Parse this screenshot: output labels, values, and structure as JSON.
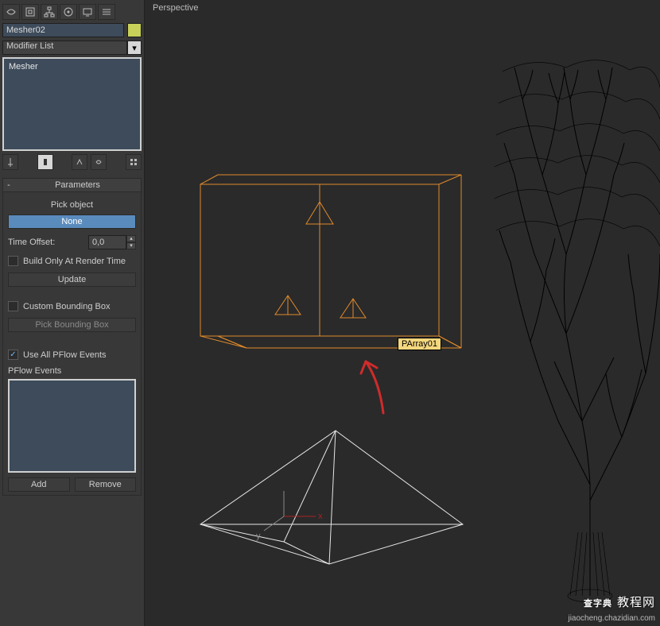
{
  "viewport": {
    "label": "Perspective"
  },
  "object": {
    "name": "Mesher02",
    "color": "#c7d058"
  },
  "modifier_list": {
    "placeholder": "Modifier List"
  },
  "modifier_stack": {
    "items": [
      "Mesher"
    ]
  },
  "rollout": {
    "title": "Parameters",
    "pick_label": "Pick object",
    "pick_btn": "None",
    "time_offset": {
      "label": "Time Offset:",
      "value": "0,0"
    },
    "build_render_only": {
      "label": "Build Only At Render Time",
      "checked": false
    },
    "update_btn": "Update",
    "custom_bb": {
      "label": "Custom Bounding Box",
      "checked": false
    },
    "pick_bb_btn": "Pick Bounding Box",
    "use_all_pflow": {
      "label": "Use All PFlow Events",
      "checked": true
    },
    "pflow_events_label": "PFlow Events",
    "add_btn": "Add",
    "remove_btn": "Remove"
  },
  "scene": {
    "selection_label": "PArray01"
  },
  "watermark": {
    "main": "查字典",
    "sub": "教程网",
    "url": "jiaocheng.chazidian.com"
  },
  "icons": {
    "top": [
      "sel-filter",
      "display",
      "hierarchy",
      "motion",
      "utilities",
      "list"
    ],
    "stack": [
      "pin",
      "show-end",
      "make-unique",
      "remove",
      "configure"
    ]
  }
}
